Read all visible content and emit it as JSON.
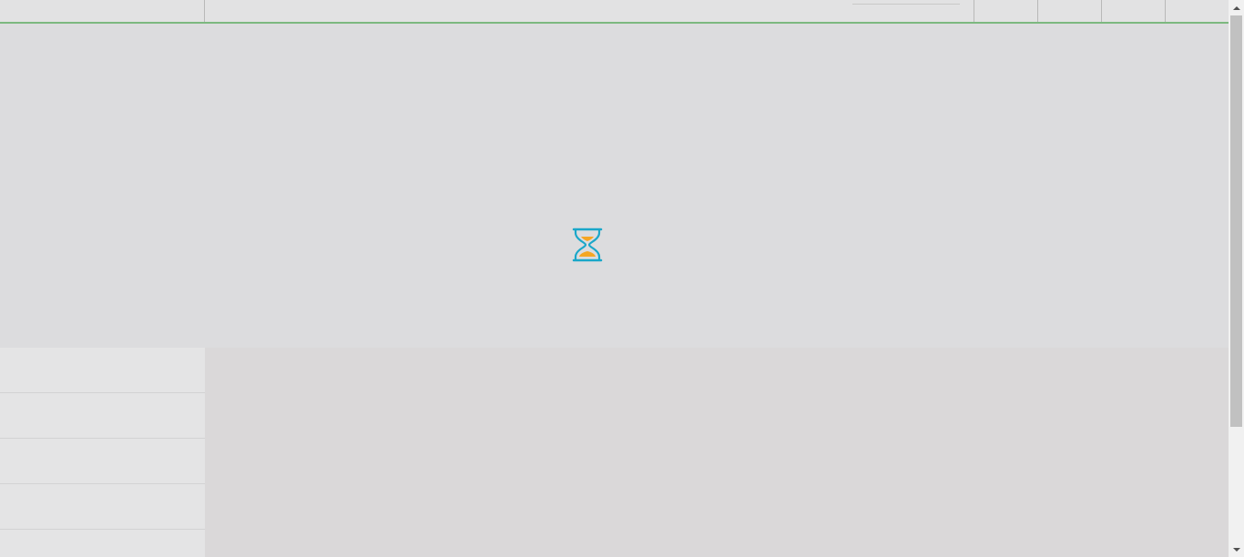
{
  "topbar": {
    "accent_color": "#7cb87f",
    "nav_buttons": [
      "",
      "",
      "",
      ""
    ]
  },
  "overlay": {
    "loading_icon": "hourglass-icon",
    "icon_colors": {
      "frame": "#1aa7c9",
      "sand": "#f5a623"
    }
  },
  "sidebar": {
    "items": [
      "",
      "",
      "",
      "",
      ""
    ]
  },
  "scrollbar": {
    "up_icon": "scroll-up-arrow-icon",
    "down_icon": "scroll-down-arrow-icon"
  }
}
